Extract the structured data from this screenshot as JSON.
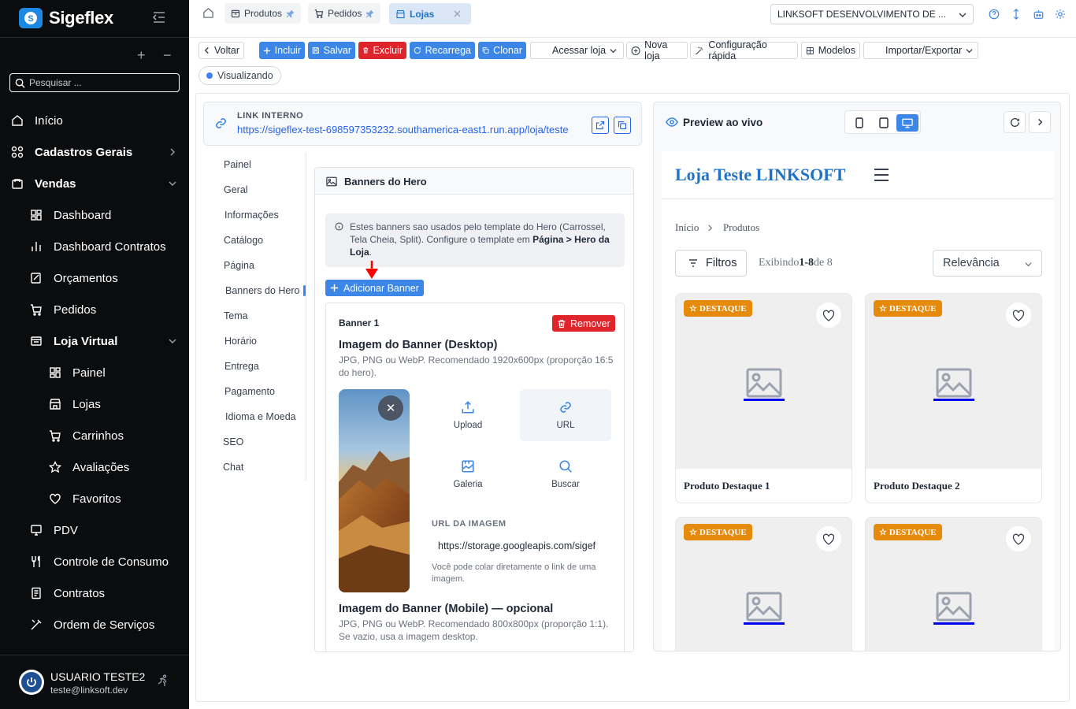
{
  "app": {
    "name": "Sigeflex"
  },
  "sidebar": {
    "search_placeholder": "Pesquisar ...",
    "items": [
      {
        "label": "Início"
      },
      {
        "label": "Cadastros Gerais"
      },
      {
        "label": "Vendas"
      },
      {
        "label": "Dashboard"
      },
      {
        "label": "Dashboard Contratos"
      },
      {
        "label": "Orçamentos"
      },
      {
        "label": "Pedidos"
      },
      {
        "label": "Loja Virtual"
      },
      {
        "label": "Painel"
      },
      {
        "label": "Lojas"
      },
      {
        "label": "Carrinhos"
      },
      {
        "label": "Avaliações"
      },
      {
        "label": "Favoritos"
      },
      {
        "label": "PDV"
      },
      {
        "label": "Controle de Consumo"
      },
      {
        "label": "Contratos"
      },
      {
        "label": "Ordem de Serviços"
      }
    ],
    "user": {
      "name": "USUARIO TESTE2",
      "email": "teste@linksoft.dev"
    }
  },
  "tabs": [
    {
      "label": "Produtos"
    },
    {
      "label": "Pedidos"
    },
    {
      "label": "Lojas"
    }
  ],
  "company": {
    "selected": "LINKSOFT DESENVOLVIMENTO DE ..."
  },
  "toolbar": {
    "back": "Voltar",
    "include": "Incluir",
    "save": "Salvar",
    "delete": "Excluir",
    "reload": "Recarrega",
    "clone": "Clonar",
    "access_store": "Acessar loja",
    "new_store": "Nova loja",
    "quick_config": "Configuração rápida",
    "models": "Modelos",
    "import_export": "Importar/Exportar",
    "status": "Visualizando"
  },
  "link": {
    "label": "LINK INTERNO",
    "url": "https://sigeflex-test-698597353232.southamerica-east1.run.app/loja/teste"
  },
  "subnav": [
    "Painel",
    "Geral",
    "Informações",
    "Catálogo",
    "Página",
    "Banners do Hero",
    "Tema",
    "Horário",
    "Entrega",
    "Pagamento",
    "Idioma e Moeda",
    "SEO",
    "Chat"
  ],
  "panel": {
    "title": "Banners do Hero",
    "info_pre": "Estes banners sao usados pelo template do Hero (Carrossel, Tela Cheia, Split). Configure o template em ",
    "info_bold": "Página > Hero da Loja",
    "info_post": ".",
    "add_button": "Adicionar Banner",
    "banner": {
      "title": "Banner 1",
      "remove": "Remover",
      "desktop_heading": "Imagem do Banner (Desktop)",
      "desktop_desc": "JPG, PNG ou WebP. Recomendado 1920x600px (proporção 16:5 do hero).",
      "options": {
        "upload": "Upload",
        "url": "URL",
        "gallery": "Galeria",
        "search": "Buscar"
      },
      "url_label": "URL DA IMAGEM",
      "url_value": "https://storage.googleapis.com/sigeflex",
      "url_help": "Você pode colar diretamente o link de uma imagem.",
      "mobile_heading": "Imagem do Banner (Mobile) — opcional",
      "mobile_desc": "JPG, PNG ou WebP. Recomendado 800x800px (proporção 1:1). Se vazio, usa a imagem desktop."
    }
  },
  "preview": {
    "title": "Preview ao vivo",
    "store_name": "Loja Teste LINKSOFT",
    "breadcrumb": [
      "Início",
      "Produtos"
    ],
    "filters": "Filtros",
    "showing_pre": "Exibindo",
    "showing_range": "1-8",
    "showing_post": "de 8",
    "sort": "Relevância",
    "badge": "DESTAQUE",
    "products": [
      {
        "name": "Produto Destaque 1"
      },
      {
        "name": "Produto Destaque 2"
      },
      {
        "name": ""
      },
      {
        "name": ""
      }
    ]
  },
  "colors": {
    "primary": "#3b86e6",
    "danger": "#e0242b",
    "sidebar_bg": "#0b0c0e",
    "badge": "#e58a0b",
    "store_title": "#1e73c8"
  }
}
